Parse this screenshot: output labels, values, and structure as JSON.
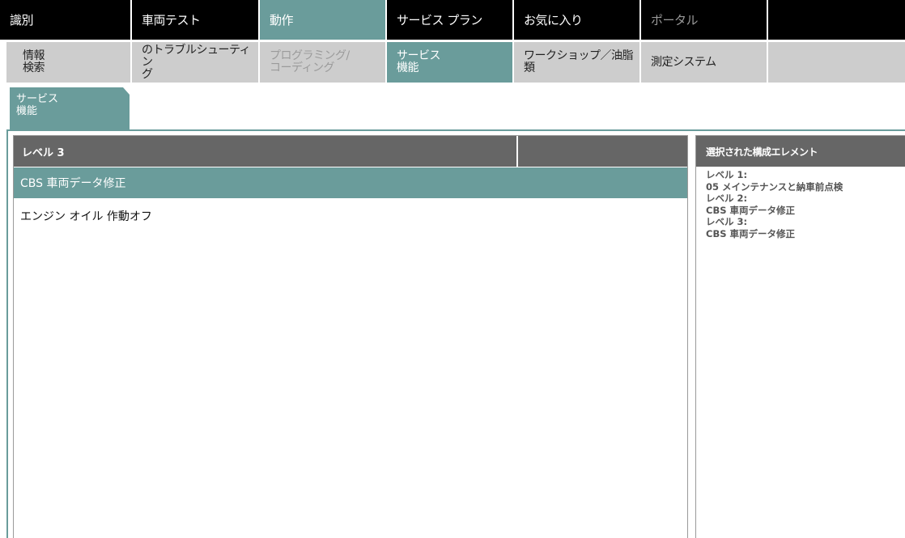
{
  "top_nav": [
    {
      "label": "識別",
      "state": "normal"
    },
    {
      "label": "車両テスト",
      "state": "normal"
    },
    {
      "label": "動作",
      "state": "active"
    },
    {
      "label": "サービス プラン",
      "state": "normal"
    },
    {
      "label": "お気に入り",
      "state": "normal"
    },
    {
      "label": "ポータル",
      "state": "disabled"
    }
  ],
  "sub_nav": [
    {
      "label": "情報\n検索",
      "state": "normal"
    },
    {
      "label": "のトラブルシューティン\nグ",
      "state": "normal"
    },
    {
      "label": "プログラミング/\nコーディング",
      "state": "disabled"
    },
    {
      "label": "サービス\n機能",
      "state": "active"
    },
    {
      "label": "ワークショップ／油脂\n類",
      "state": "normal"
    },
    {
      "label": "測定システム",
      "state": "normal"
    }
  ],
  "section_tab": "サービス\n機能",
  "list_panel": {
    "header": "レベル 3",
    "selected_row": "CBS 車両データ修正",
    "rows": [
      "エンジン オイル 作動オフ"
    ]
  },
  "details_panel": {
    "header": "選択された構成エレメント",
    "level1_label": "レベル 1:",
    "level1_value": "05 メインテナンスと納車前点検",
    "level2_label": "レベル 2:",
    "level2_value": "CBS 車両データ修正",
    "level3_label": "レベル 3:",
    "level3_value": "CBS 車両データ修正"
  },
  "colors": {
    "accent": "#6a9c9b",
    "header_gray": "#666666",
    "subnav_gray": "#cdcdcd"
  }
}
